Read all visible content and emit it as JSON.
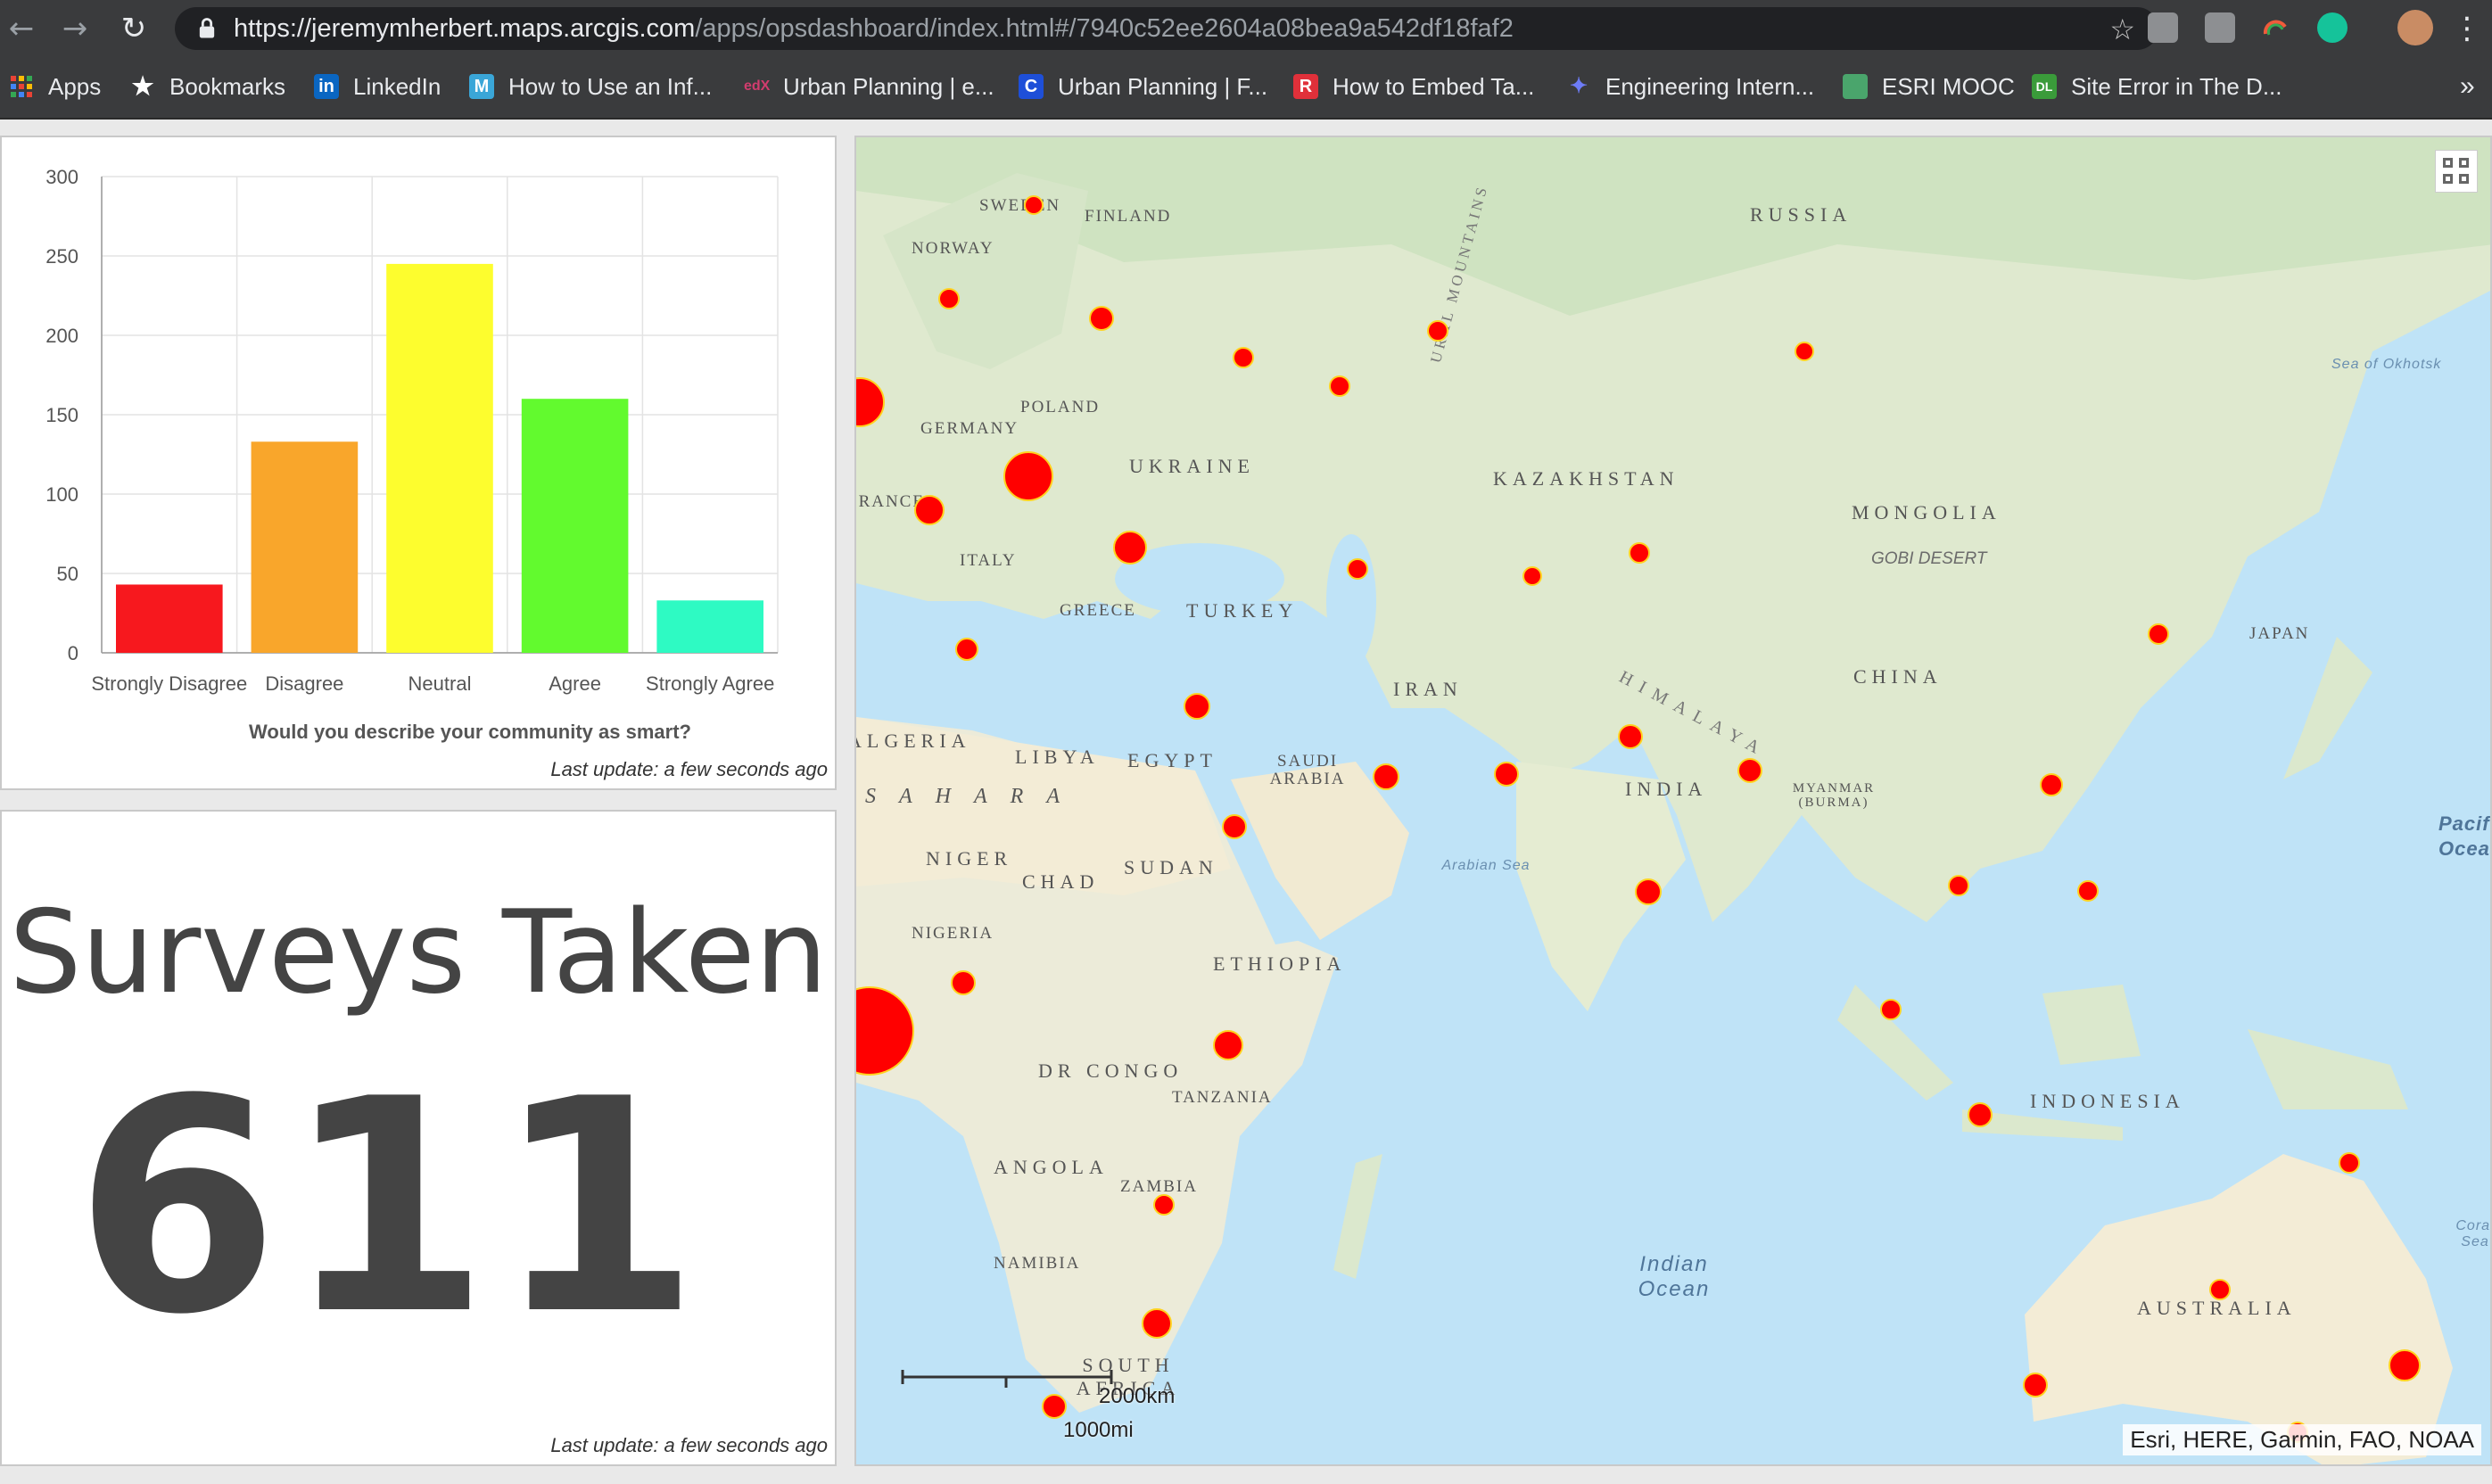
{
  "browser": {
    "url_main": "https://jeremymherbert.maps.arcgis.com",
    "url_rest": "/apps/opsdashboard/index.html#/7940c52ee2604a08bea9a542df18faf2"
  },
  "bookmarks": [
    {
      "label": "Apps",
      "icon": "apps-grid-icon",
      "color": "#e94335"
    },
    {
      "label": "Bookmarks",
      "icon": "star-icon",
      "color": "#e8eaed"
    },
    {
      "label": "LinkedIn",
      "icon": "linkedin-icon",
      "color": "#0a66c2"
    },
    {
      "label": "How to Use an Inf...",
      "icon": "m-icon",
      "color": "#3aa6d8"
    },
    {
      "label": "Urban Planning | e...",
      "icon": "edx-icon",
      "color": "#d23c6e"
    },
    {
      "label": "Urban Planning | F...",
      "icon": "coursera-icon",
      "color": "#1e4fd8"
    },
    {
      "label": "How to Embed Ta...",
      "icon": "r-icon",
      "color": "#e0303a"
    },
    {
      "label": "Engineering Intern...",
      "icon": "spark-icon",
      "color": "#4355f3"
    },
    {
      "label": "ESRI MOOC",
      "icon": "globe-icon",
      "color": "#4aa56c"
    },
    {
      "label": "Site Error in The D...",
      "icon": "dl-icon",
      "color": "#3a9b3a"
    }
  ],
  "bookmarks_overflow": "»",
  "chart_data": {
    "type": "bar",
    "title": "",
    "xlabel": "Would you describe your community as smart?",
    "ylabel": "",
    "categories": [
      "Strongly Disagree",
      "Disagree",
      "Neutral",
      "Agree",
      "Strongly Agree"
    ],
    "values": [
      43,
      133,
      245,
      160,
      33
    ],
    "colors": [
      "#f7181e",
      "#f9a62b",
      "#fdfd2e",
      "#62fa2e",
      "#2efac3"
    ],
    "ylim": [
      0,
      300
    ],
    "yticks": [
      0,
      50,
      100,
      150,
      200,
      250,
      300
    ],
    "grid": true
  },
  "chart_updated": "Last update: a few seconds ago",
  "indicator": {
    "title": "Surveys Taken",
    "value": "611",
    "updated": "Last update: a few seconds ago"
  },
  "map": {
    "labels": {
      "sweden": "SWEDEN",
      "finland": "FINLAND",
      "norway": "NORWAY",
      "russia": "RUSSIA",
      "poland": "POLAND",
      "germany": "GERMANY",
      "france": "FRANCE",
      "ukraine": "UKRAINE",
      "kazakhstan": "KAZAKHSTAN",
      "mongolia": "MONGOLIA",
      "gobi": "GOBI DESERT",
      "italy": "ITALY",
      "greece": "GREECE",
      "turkey": "TURKEY",
      "japan": "JAPAN",
      "iran": "IRAN",
      "china": "CHINA",
      "himalaya": "HIMALAYA",
      "algeria": "ALGERIA",
      "libya": "LIBYA",
      "egypt": "EGYPT",
      "saudi": "SAUDI ARABIA",
      "india": "INDIA",
      "myanmar": "MYANMAR (BURMA)",
      "sahara": "SAHARA",
      "niger": "NIGER",
      "chad": "CHAD",
      "sudan": "SUDAN",
      "nigeria": "NIGERIA",
      "ethiopia": "ETHIOPIA",
      "drc": "DR CONGO",
      "tanzania": "TANZANIA",
      "indonesia": "INDONESIA",
      "angola": "ANGOLA",
      "zambia": "ZAMBIA",
      "namibia": "NAMIBIA",
      "south_africa": "SOUTH AFRICA",
      "australia": "AUSTRALIA",
      "ural": "URAL MOUNTAINS",
      "okhotsk": "Sea of Okhotsk",
      "arabian": "Arabian Sea",
      "indian_ocean": "Indian Ocean",
      "coral": "Coral Sea",
      "pacific": "Pacific Ocean"
    },
    "scale_km": "2000km",
    "scale_mi": "1000mi",
    "attribution": "Esri, HERE, Garmin, FAO, NOAA"
  }
}
